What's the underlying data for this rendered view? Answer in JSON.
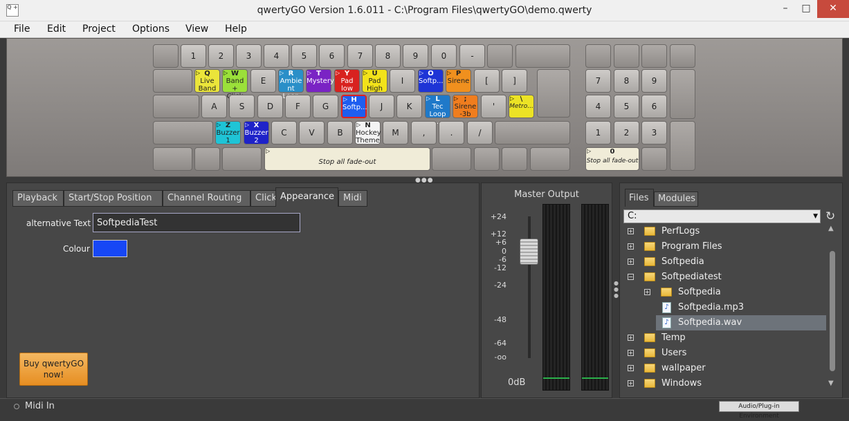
{
  "window": {
    "title": "qwertyGO Version 1.6.011 - C:\\Program Files\\qwertyGO\\demo.qwerty",
    "app_icon": "Q +",
    "min": "–",
    "max": "□",
    "close": "✕"
  },
  "menu": [
    "File",
    "Edit",
    "Project",
    "Options",
    "View",
    "Help"
  ],
  "keys": {
    "n1": "1",
    "n2": "2",
    "n3": "3",
    "n4": "4",
    "n5": "5",
    "n6": "6",
    "n7": "7",
    "n8": "8",
    "n9": "9",
    "n0": "0",
    "minus": "-",
    "q": {
      "letter": "Q",
      "name": "Live Band"
    },
    "w": {
      "letter": "W",
      "name": "Band + Click"
    },
    "e": "E",
    "r": {
      "letter": "R",
      "name": "Ambie nt Loop"
    },
    "t": {
      "letter": "T",
      "name": "Mystery"
    },
    "y": {
      "letter": "Y",
      "name": "Pad low"
    },
    "u": {
      "letter": "U",
      "name": "Pad High"
    },
    "i": "I",
    "o": {
      "letter": "O",
      "name": "Softp..."
    },
    "p": {
      "letter": "P",
      "name": "Sirene"
    },
    "lbr": "[",
    "rbr": "]",
    "a": "A",
    "s": "S",
    "d": "D",
    "f": "F",
    "g": "G",
    "h": {
      "letter": "H",
      "name": "Softp..."
    },
    "j": "J",
    "k": "K",
    "l": {
      "letter": "L",
      "name": "Tec Loop ..."
    },
    "semi": {
      "letter": ";",
      "name": "Sirene -3b"
    },
    "quote": "'",
    "bslash": {
      "letter": "\\",
      "name": "Metro..."
    },
    "z": {
      "letter": "Z",
      "name": "Buzzer 1"
    },
    "x": {
      "letter": "X",
      "name": "Buzzer 2"
    },
    "c": "C",
    "v": "V",
    "b": "B",
    "n": {
      "letter": "N",
      "name": "Hockey Theme"
    },
    "m": "M",
    "comma": ",",
    "dot": ".",
    "slash": "/",
    "space": "Stop all fade-out",
    "np7": "7",
    "np8": "8",
    "np9": "9",
    "np4": "4",
    "np5": "5",
    "np6": "6",
    "np1": "1",
    "np2": "2",
    "np3": "3",
    "np0": {
      "letter": "0",
      "name": "Stop all fade-out"
    }
  },
  "tabs": [
    "Playback",
    "Start/Stop Position",
    "Channel Routing",
    "Click",
    "Appearance",
    "Midi"
  ],
  "appearance": {
    "alt_text_label": "alternative Text",
    "alt_text_value": "SoftpediaTest",
    "colour_label": "Colour",
    "colour": "#1747f5"
  },
  "buy_button": "Buy qwertyGO now!",
  "master": {
    "title": "Master Output",
    "scale": [
      "+24",
      "+12",
      "+6",
      "0",
      "-6",
      "-12",
      "-24",
      "-48",
      "-64",
      "-oo"
    ],
    "db_value": "0dB",
    "level": 0
  },
  "files": {
    "tabs": [
      "Files",
      "Modules"
    ],
    "drive": "C:",
    "refresh_icon": "↻",
    "tree": [
      {
        "label": "PerfLogs",
        "expander": "+"
      },
      {
        "label": "Program Files",
        "expander": "+"
      },
      {
        "label": "Softpedia",
        "expander": "+"
      },
      {
        "label": "Softpediatest",
        "expander": "−"
      },
      {
        "label": "Softpedia",
        "expander": "+"
      },
      {
        "label": "Softpedia.mp3"
      },
      {
        "label": "Softpedia.wav"
      },
      {
        "label": "Temp",
        "expander": "+"
      },
      {
        "label": "Users",
        "expander": "+"
      },
      {
        "label": "wallpaper",
        "expander": "+"
      },
      {
        "label": "Windows",
        "expander": "+"
      }
    ]
  },
  "status": {
    "midi_in": "Midi In",
    "env_button": "Audio/Plug-in Environment"
  }
}
